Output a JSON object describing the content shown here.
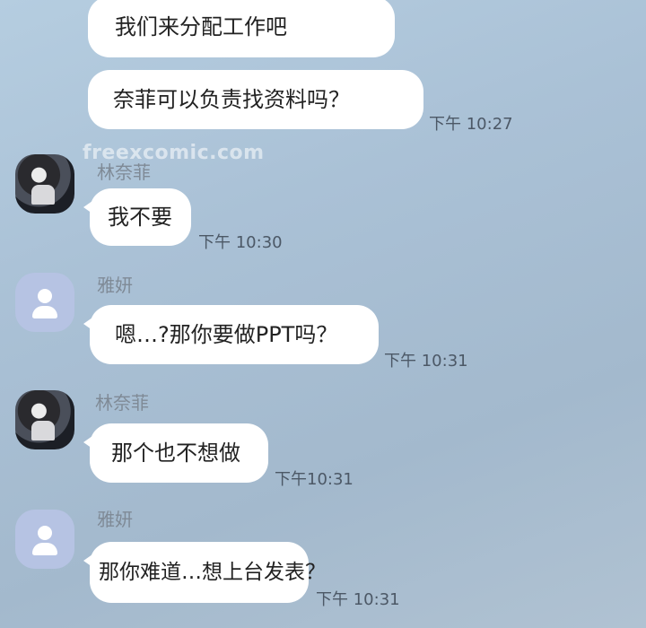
{
  "watermark": "freexcomic.com",
  "icons": {
    "default_avatar": "person-icon"
  },
  "messages": [
    {
      "text": "我们来分配工作吧",
      "time": ""
    },
    {
      "text": "奈菲可以负责找资料吗？",
      "time": "下午 10:27"
    },
    {
      "sender": "林奈菲",
      "text": "我不要",
      "time": "下午 10:30"
    },
    {
      "sender": "雅妍",
      "text": "嗯…?那你要做PPT吗？",
      "time": "下午 10:31"
    },
    {
      "sender": "林奈菲",
      "text": "那个也不想做",
      "time": "下午10:31"
    },
    {
      "sender": "雅妍",
      "text": "那你难道…想上台发表？",
      "time": "下午 10:31"
    }
  ]
}
